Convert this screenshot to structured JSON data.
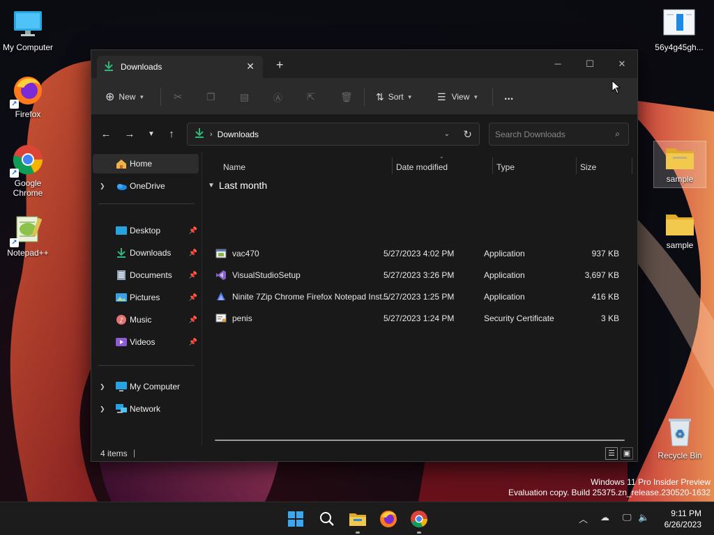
{
  "desktop": {
    "icons": [
      {
        "label": "My Computer"
      },
      {
        "label": "Firefox"
      },
      {
        "label": "Google Chrome"
      },
      {
        "label": "Notepad++"
      },
      {
        "label": "56y4g45gh..."
      },
      {
        "label": "sample"
      },
      {
        "label": "sample"
      },
      {
        "label": "Recycle Bin"
      }
    ]
  },
  "window": {
    "tab_title": "Downloads",
    "toolbar": {
      "new_label": "New",
      "sort_label": "Sort",
      "view_label": "View",
      "more_label": "..."
    },
    "address": {
      "path": "Downloads",
      "search_placeholder": "Search Downloads"
    },
    "nav": {
      "items": [
        {
          "label": "Home"
        },
        {
          "label": "OneDrive"
        },
        {
          "label": "Desktop"
        },
        {
          "label": "Downloads"
        },
        {
          "label": "Documents"
        },
        {
          "label": "Pictures"
        },
        {
          "label": "Music"
        },
        {
          "label": "Videos"
        },
        {
          "label": "My Computer"
        },
        {
          "label": "Network"
        }
      ]
    },
    "columns": {
      "name": "Name",
      "date": "Date modified",
      "type": "Type",
      "size": "Size"
    },
    "group": "Last month",
    "files": [
      {
        "name": "vac470",
        "date": "5/27/2023 4:02 PM",
        "type": "Application",
        "size": "937 KB"
      },
      {
        "name": "VisualStudioSetup",
        "date": "5/27/2023 3:26 PM",
        "type": "Application",
        "size": "3,697 KB"
      },
      {
        "name": "Ninite 7Zip Chrome Firefox Notepad Inst...",
        "date": "5/27/2023 1:25 PM",
        "type": "Application",
        "size": "416 KB"
      },
      {
        "name": "penis",
        "date": "5/27/2023 1:24 PM",
        "type": "Security Certificate",
        "size": "3 KB"
      }
    ],
    "status": "4 items"
  },
  "watermark": {
    "line1": "Windows 11 Pro Insider Preview",
    "line2": "Evaluation copy. Build 25375.zn_release.230520-1632"
  },
  "clock": {
    "time": "9:11 PM",
    "date": "6/26/2023"
  },
  "colors": {
    "accent_green": "#2fb67c",
    "folder_yellow": "#f2c94c",
    "wallpaper_red": "#c9302c"
  }
}
